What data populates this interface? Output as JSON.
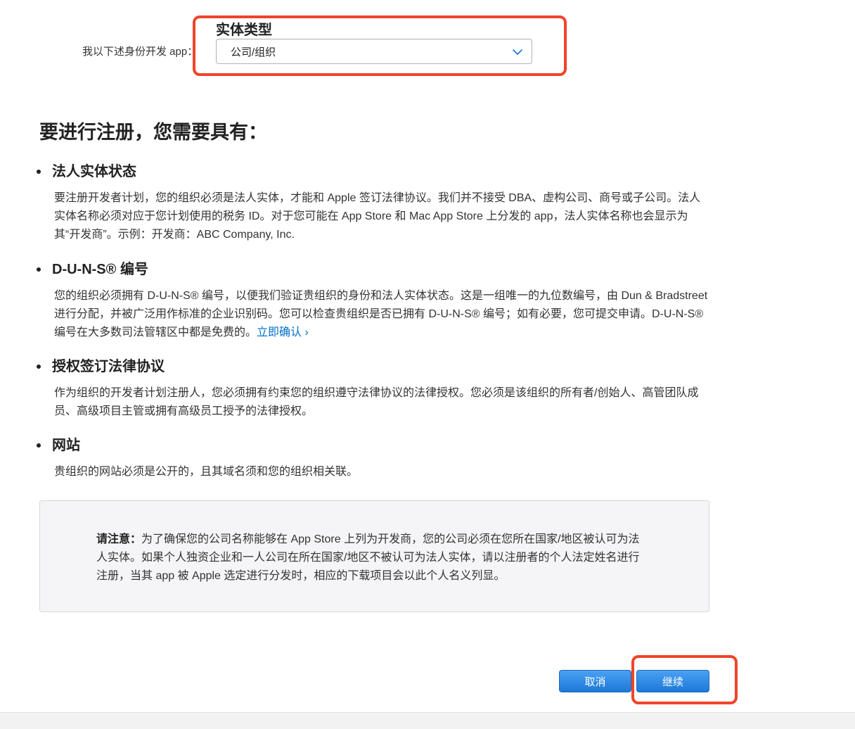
{
  "entity": {
    "prompt": "我以下述身份开发 app：",
    "annotation_label": "实体类型",
    "selected_value": "公司/组织"
  },
  "main": {
    "heading": "要进行注册，您需要具有：",
    "requirements": [
      {
        "title": "法人实体状态",
        "body": "要注册开发者计划，您的组织必须是法人实体，才能和 Apple 签订法律协议。我们并不接受 DBA、虚构公司、商号或子公司。法人实体名称必须对应于您计划使用的税务 ID。对于您可能在 App Store 和 Mac App Store 上分发的 app，法人实体名称也会显示为其“开发商”。示例：开发商：ABC Company, Inc."
      },
      {
        "title": "D-U-N-S® 编号",
        "body": "您的组织必须拥有 D-U-N-S® 编号，以便我们验证贵组织的身份和法人实体状态。这是一组唯一的九位数编号，由 Dun & Bradstreet 进行分配，并被广泛用作标准的企业识别码。您可以检查贵组织是否已拥有 D-U-N-S® 编号；如有必要，您可提交申请。D-U-N-S® 编号在大多数司法管辖区中都是免费的。",
        "link": "立即确认 ›"
      },
      {
        "title": "授权签订法律协议",
        "body": "作为组织的开发者计划注册人，您必须拥有约束您的组织遵守法律协议的法律授权。您必须是该组织的所有者/创始人、高管团队成员、高级项目主管或拥有高级员工授予的法律授权。"
      },
      {
        "title": "网站",
        "body": "贵组织的网站必须是公开的，且其域名须和您的组织相关联。"
      }
    ]
  },
  "note": {
    "label": "请注意：",
    "text": "为了确保您的公司名称能够在 App Store 上列为开发商，您的公司必须在您所在国家/地区被认可为法人实体。如果个人独资企业和一人公司在所在国家/地区不被认可为法人实体，请以注册者的个人法定姓名进行注册，当其 app 被 Apple 选定进行分发时，相应的下载项目会以此个人名义列显。"
  },
  "buttons": {
    "cancel": "取消",
    "continue": "继续"
  },
  "colors": {
    "highlight": "#f0442a",
    "button": "#1d78d8",
    "link": "#0070c9"
  }
}
